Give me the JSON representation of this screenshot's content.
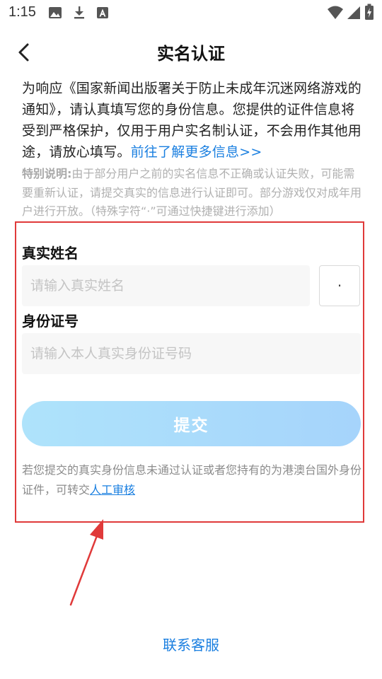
{
  "status_bar": {
    "time": "1:15",
    "icons": [
      "image-icon",
      "download-icon",
      "text-a-icon",
      "wifi-icon",
      "signal-icon",
      "battery-icon"
    ]
  },
  "header": {
    "title": "实名认证",
    "back_icon": "chevron-left-icon"
  },
  "intro": {
    "text": "为响应《国家新闻出版署关于防止未成年沉迷网络游戏的通知》，请认真填写您的身份信息。您提供的证件信息将受到严格保护，仅用于用户实名制认证，不会用作其他用途，请放心填写。",
    "link": "前往了解更多信息>>"
  },
  "note": {
    "label": "特别说明:",
    "text": "由于部分用户之前的实名信息不正确或认证失败，可能需要重新认证，请提交真实的信息进行认证即可。部分游戏仅对成年用户进行开放。（特殊字符“·”可通过快捷键进行添加）"
  },
  "form": {
    "name_label": "真实姓名",
    "name_placeholder": "请输入真实姓名",
    "dot_button": "·",
    "id_label": "身份证号",
    "id_placeholder": "请输入本人真实身份证号码",
    "submit": "提交"
  },
  "footer": {
    "text": "若您提交的真实身份信息未通过认证或者您持有的为港澳台国外身份证件，可转交",
    "link": "人工审核"
  },
  "contact": "联系客服",
  "colors": {
    "link": "#1a7fe0",
    "annotation": "#e03a3a",
    "submit_gradient_start": "#aee3fb",
    "submit_gradient_end": "#a6d4fb"
  }
}
